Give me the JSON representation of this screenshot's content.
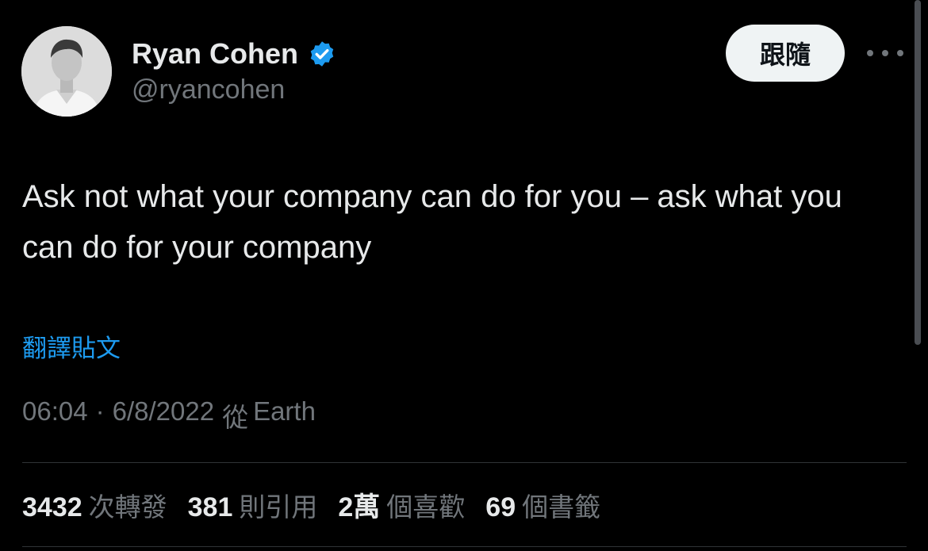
{
  "author": {
    "name": "Ryan Cohen",
    "handle": "@ryancohen",
    "verified_color": "#1d9bf0"
  },
  "header": {
    "follow_label": "跟隨",
    "more_icon": "more-horizontal-icon"
  },
  "tweet": {
    "text": "Ask not what your company can do for you – ask what you can do for your company",
    "translate_label": "翻譯貼文"
  },
  "meta": {
    "time": "06:04",
    "separator": "·",
    "date": "6/8/2022",
    "source_prefix": "從",
    "source": "Earth"
  },
  "stats": [
    {
      "value": "3432",
      "label": "次轉發"
    },
    {
      "value": "381",
      "label": "則引用"
    },
    {
      "value": "2萬",
      "label": "個喜歡"
    },
    {
      "value": "69",
      "label": "個書籤"
    }
  ],
  "colors": {
    "background": "#000000",
    "text": "#e7e9ea",
    "secondary": "#71767b",
    "accent": "#1d9bf0"
  }
}
